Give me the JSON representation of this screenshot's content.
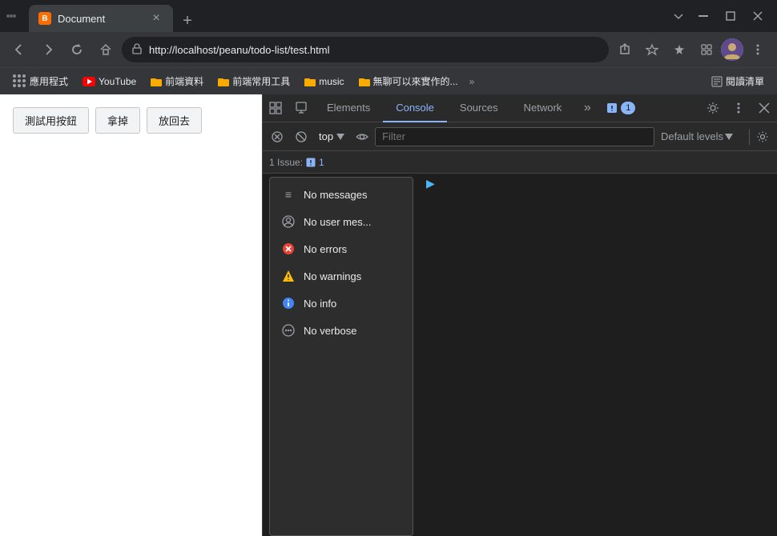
{
  "titlebar": {
    "tab_title": "Document",
    "tab_icon": "B",
    "close_label": "×",
    "new_tab_label": "+",
    "win_minimize": "—",
    "win_restore": "❐",
    "win_close": "✕"
  },
  "addressbar": {
    "url_full": "http://localhost/peanu/todo-list/test.html",
    "url_display": "http://localhost/peanu/todo-list/test.html",
    "back_title": "Back",
    "forward_title": "Forward",
    "reload_title": "Reload",
    "home_title": "Home"
  },
  "bookmarks": {
    "items": [
      {
        "label": "應用程式",
        "icon": "grid"
      },
      {
        "label": "YouTube",
        "icon": "youtube"
      },
      {
        "label": "前端資料",
        "icon": "folder"
      },
      {
        "label": "前端常用工具",
        "icon": "folder"
      },
      {
        "label": "music",
        "icon": "folder"
      },
      {
        "label": "無聊可以來實作的...",
        "icon": "folder"
      }
    ],
    "more_label": "»",
    "reading_mode": "閱讀清單"
  },
  "page": {
    "buttons": [
      {
        "label": "測試用按鈕"
      },
      {
        "label": "拿掉"
      },
      {
        "label": "放回去"
      }
    ]
  },
  "devtools": {
    "tabs": [
      {
        "label": "Elements",
        "active": false
      },
      {
        "label": "Console",
        "active": true
      },
      {
        "label": "Sources",
        "active": false
      },
      {
        "label": "Network",
        "active": false
      }
    ],
    "more_tabs_label": "»",
    "issues_badge": "1",
    "issues_label": "1 Issue:",
    "console_context": "top",
    "filter_placeholder": "Filter",
    "default_levels_label": "Default levels",
    "dropdown_items": [
      {
        "label": "No messages",
        "icon": "≡",
        "icon_color": "#9aa0a6"
      },
      {
        "label": "No user mes...",
        "icon": "⊘",
        "icon_color": "#9aa0a6"
      },
      {
        "label": "No errors",
        "icon": "✕",
        "icon_color": "#ea4335"
      },
      {
        "label": "No warnings",
        "icon": "⚠",
        "icon_color": "#fbbc04"
      },
      {
        "label": "No info",
        "icon": "ℹ",
        "icon_color": "#4285f4"
      },
      {
        "label": "No verbose",
        "icon": "⚙",
        "icon_color": "#9aa0a6"
      }
    ],
    "arrow_symbol": "▶"
  }
}
